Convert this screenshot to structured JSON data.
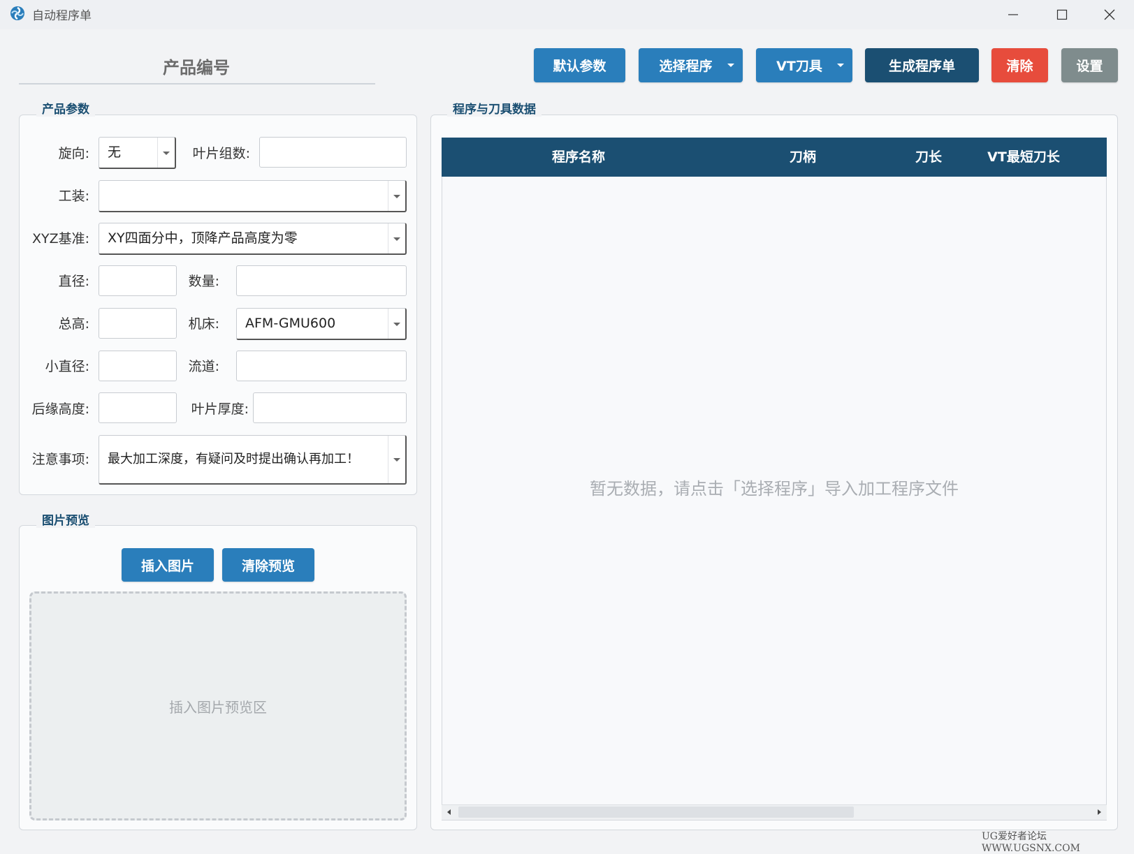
{
  "window": {
    "title": "自动程序单",
    "controls": {
      "minimize": "minimize-icon",
      "maximize": "maximize-icon",
      "close": "close-icon"
    }
  },
  "header": {
    "product_no_label": "产品编号"
  },
  "toolbar": {
    "default_params": "默认参数",
    "select_program": "选择程序",
    "vt_tool": "VT刀具",
    "generate": "生成程序单",
    "clear": "清除",
    "settings": "设置"
  },
  "product_params": {
    "title": "产品参数",
    "rotation_label": "旋向:",
    "rotation_value": "无",
    "blade_groups_label": "叶片组数:",
    "blade_groups_value": "",
    "fixture_label": "工装:",
    "fixture_value": "",
    "xyz_label": "XYZ基准:",
    "xyz_value": "XY四面分中，顶降产品高度为零",
    "diameter_label": "直径:",
    "diameter_value": "",
    "quantity_label": "数量:",
    "quantity_value": "",
    "total_height_label": "总高:",
    "total_height_value": "",
    "machine_label": "机床:",
    "machine_value": "AFM-GMU600",
    "small_diameter_label": "小直径:",
    "small_diameter_value": "",
    "runner_label": "流道:",
    "runner_value": "",
    "trailing_height_label": "后缘高度:",
    "trailing_height_value": "",
    "blade_thickness_label": "叶片厚度:",
    "blade_thickness_value": "",
    "notes_label": "注意事项:",
    "notes_value": "最大加工深度，有疑问及时提出确认再加工！"
  },
  "image_preview": {
    "title": "图片预览",
    "insert_button": "插入图片",
    "clear_button": "清除预览",
    "placeholder": "插入图片预览区"
  },
  "program_data": {
    "title": "程序与刀具数据",
    "columns": [
      "程序名称",
      "刀柄",
      "刀长",
      "VT最短刀长"
    ],
    "rows": [],
    "empty_message": "暂无数据，请点击「选择程序」导入加工程序文件"
  },
  "watermark": "UG爱好者论坛 WWW.UGSNX.COM",
  "colors": {
    "primary": "#2a7ebb",
    "dark": "#1b4f72",
    "danger": "#e74c3c",
    "neutral": "#7f8c8d"
  }
}
